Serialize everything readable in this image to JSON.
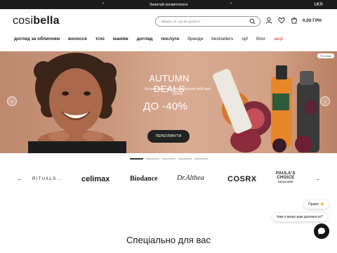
{
  "topbar": {
    "message": "Запитай косметолога",
    "lang": "UKR",
    "prev_icon": "chevron-left-icon",
    "next_icon": "chevron-right-icon"
  },
  "header": {
    "logo_light": "cosi",
    "logo_bold": "bella",
    "search_placeholder": "Введіть те, що ви шукаєте",
    "cart_total": "0,00 ГРН",
    "icons": [
      "search-icon",
      "user-icon",
      "heart-icon",
      "cart-icon"
    ]
  },
  "nav": [
    {
      "label": "догляд за обличчям",
      "style": "bold"
    },
    {
      "label": "волосся",
      "style": "bold"
    },
    {
      "label": "тіло",
      "style": "bold"
    },
    {
      "label": "макіяж",
      "style": "bold"
    },
    {
      "label": "догляд",
      "style": "bold"
    },
    {
      "label": "послуги",
      "style": "bold"
    },
    {
      "label": "бренди",
      "style": "light"
    },
    {
      "label": "bestsellers",
      "style": "light"
    },
    {
      "label": "spf",
      "style": "light"
    },
    {
      "label": "блог",
      "style": "light"
    },
    {
      "label": "акції",
      "style": "sale"
    }
  ],
  "hero": {
    "badge": "Реклама",
    "title": "AUTUMN DEALS",
    "subtitle": "Косметика, яка знадобиться тобі цієї осені",
    "discount": "ДО -40%",
    "cta": "ПЕРЕГЛЯНУТИ",
    "prev": "‹",
    "next": "›",
    "slides_total": 5,
    "active_slide": 1
  },
  "brands": [
    "RITUALS...",
    "celimax",
    "Biodance",
    "Dr.Althea",
    "COSRX"
  ],
  "brand_paulas": {
    "line1": "PAULA'S",
    "line2": "CHOICE",
    "line3": "SKINCARE"
  },
  "brands_prev": "←",
  "brands_next": "→",
  "chat": {
    "greeting": "Привіт 👋",
    "question": "Чим я можу вам допомогти?"
  },
  "section_title": "Спеціально для вас",
  "colors": {
    "topbar": "#1c1c1c",
    "hero_bg": "#c9957c",
    "sale": "#d23b3b",
    "button": "#222222"
  }
}
